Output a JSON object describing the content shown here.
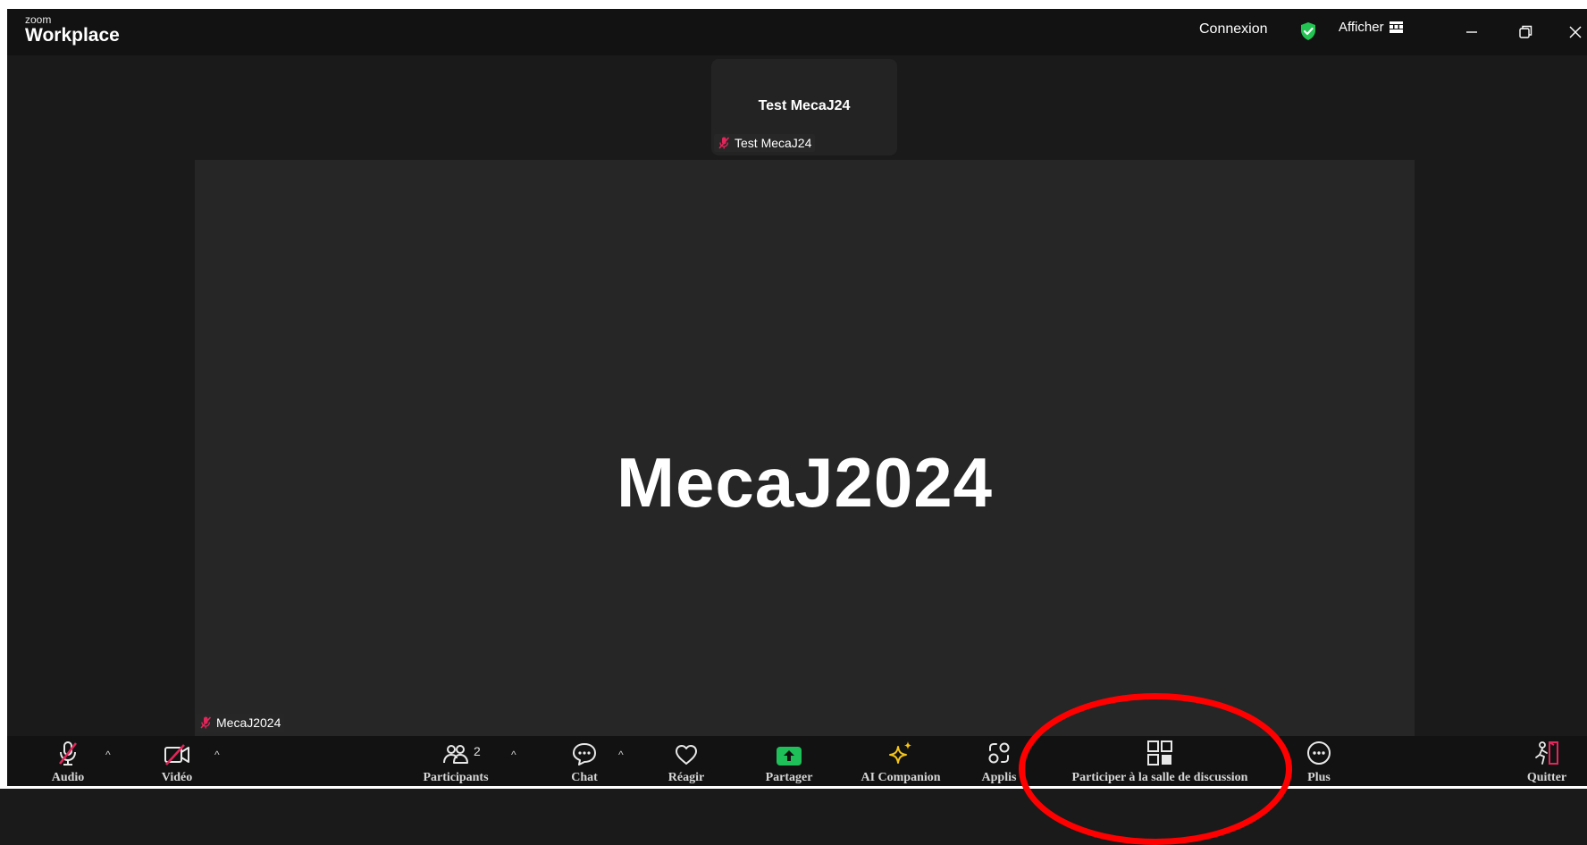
{
  "titlebar": {
    "brand_small": "zoom",
    "brand_big": "Workplace",
    "signin": "Connexion",
    "view_label": "Afficher",
    "shield_color": "#23c552"
  },
  "thumbnail": {
    "display_name": "Test MecaJ24",
    "tag": "Test MecaJ24"
  },
  "main": {
    "display_name": "MecaJ2024",
    "tag": "MecaJ2024"
  },
  "toolbar": {
    "audio": "Audio",
    "video": "Vidéo",
    "participants": "Participants",
    "participants_count": "2",
    "chat": "Chat",
    "react": "Réagir",
    "share": "Partager",
    "ai": "AI Companion",
    "apps": "Applis",
    "breakout": "Participer à la salle de discussion",
    "more": "Plus",
    "leave": "Quitter"
  },
  "colors": {
    "muted": "#e0265a",
    "share_green": "#1fbf5a",
    "ai_yellow": "#f5c518",
    "leave_red": "#e0265a",
    "highlight": "#ff0000"
  }
}
